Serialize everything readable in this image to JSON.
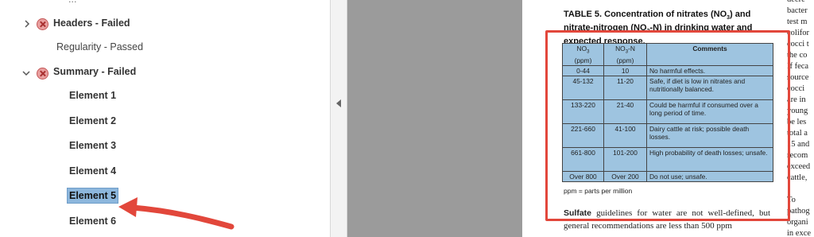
{
  "tree": {
    "top_partial_label": "...",
    "items": [
      {
        "label": "Headers - Failed",
        "bold": true,
        "expanded": false,
        "status": "failed"
      },
      {
        "label": "Regularity - Passed",
        "bold": false
      },
      {
        "label": "Summary - Failed",
        "bold": true,
        "expanded": true,
        "status": "failed"
      },
      {
        "label": "Element 1",
        "bold": true
      },
      {
        "label": "Element 2",
        "bold": true
      },
      {
        "label": "Element 3",
        "bold": true
      },
      {
        "label": "Element 4",
        "bold": true
      },
      {
        "label": "Element 5",
        "bold": true,
        "selected": true
      },
      {
        "label": "Element 6",
        "bold": true
      }
    ]
  },
  "document": {
    "title_part1": "TABLE 5. Concentration of nitrates (NO",
    "title_sub1": "3",
    "title_part2": ") and nitrate-nitrogen (NO",
    "title_sub2": "3",
    "title_part3": "-N) in drinking water and expected response.",
    "table": {
      "headers": [
        "NO3 (ppm)",
        "NO3-N (ppm)",
        "Comments"
      ],
      "rows": [
        [
          "0-44",
          "10",
          "No harmful effects."
        ],
        [
          "45-132",
          "11-20",
          "Safe, if diet is low in nitrates and nutritionally balanced."
        ],
        [
          "133-220",
          "21-40",
          "Could be harmful if consumed over a long period of time."
        ],
        [
          "221-660",
          "41-100",
          "Dairy cattle at risk; possible death losses."
        ],
        [
          "661-800",
          "101-200",
          "High probability of death losses; unsafe."
        ],
        [
          "Over 800",
          "Over 200",
          "Do not use; unsafe."
        ]
      ]
    },
    "ppm_note": "ppm = parts per million",
    "body_bold": "Sulfate",
    "body_rest": " guidelines for water are not well-defined, but general recommendations are less than 500 ppm",
    "right_column": [
      "bacter",
      "test m",
      "colifor",
      "cocci t",
      "the co",
      "If feca",
      "source",
      "cocci",
      "are in",
      "young",
      "be les",
      "total a",
      "15 and",
      "recom",
      "exceed",
      "cattle,",
      "",
      "To",
      "pathog",
      "organi",
      "in exce"
    ],
    "right_column_top": "decre"
  },
  "colors": {
    "highlight": "#e2473b",
    "selection": "#8db7dd",
    "table_fill": "#9ec4e0",
    "viewer_bg": "#9b9b9b"
  }
}
